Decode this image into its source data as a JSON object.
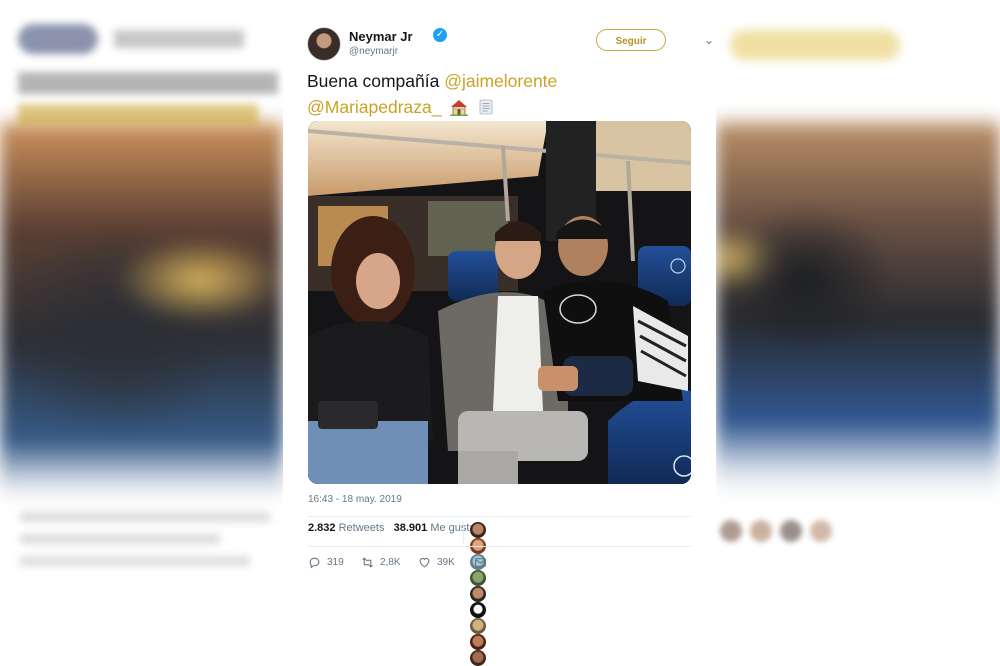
{
  "tweet": {
    "author_name": "Neymar Jr",
    "author_handle": "@neymarjr",
    "follow_label": "Seguir",
    "text_plain": "Buena compañía ",
    "mention1": "@jaimelorente",
    "mention2": "@Mariapedraza_",
    "timestamp": "16:43 - 18 may. 2019",
    "retweets_count": "2.832",
    "retweets_label": "Retweets",
    "likes_count": "38.901",
    "likes_label": "Me gusta",
    "replies": "319",
    "retweets_short": "2,8K",
    "likes_short": "39K"
  },
  "icons": [
    "verified-badge-icon",
    "chevron-down-icon",
    "house-emoji-icon",
    "scroll-emoji-icon",
    "reply-icon",
    "retweet-icon",
    "like-icon",
    "message-icon"
  ],
  "colors": {
    "accent": "#c9a227",
    "verified": "#1da1f2",
    "muted": "#657786"
  }
}
